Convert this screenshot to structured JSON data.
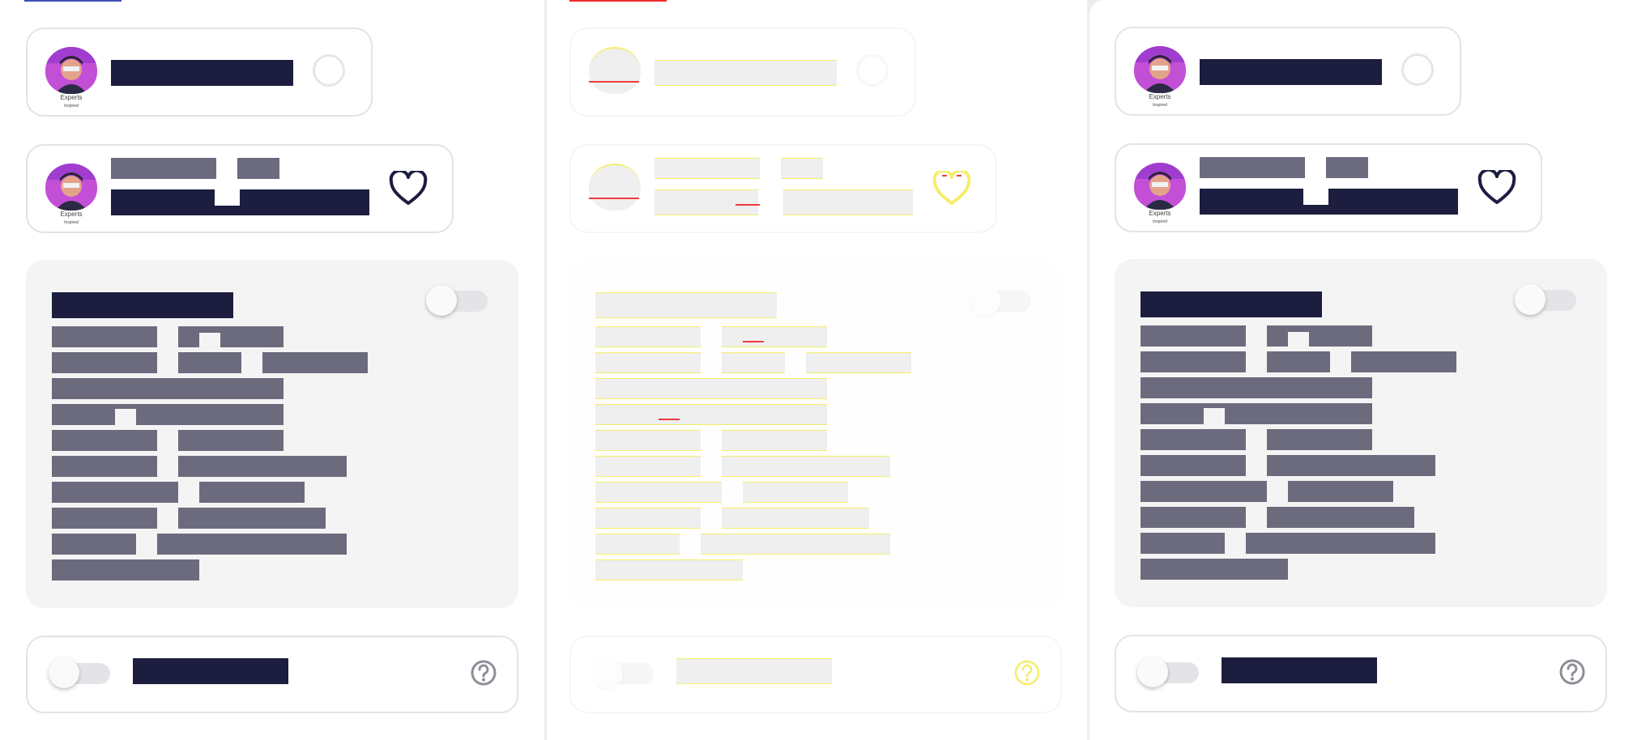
{
  "panels": [
    {
      "name": "variant-left",
      "state": "normal",
      "accent": "#3f51b5",
      "avatar_logo": "Experts",
      "avatar_sub": "Inspired"
    },
    {
      "name": "variant-middle",
      "state": "skeleton",
      "accent": "#ef2b2b",
      "avatar_logo": "",
      "avatar_sub": ""
    },
    {
      "name": "variant-right",
      "state": "normal",
      "accent": "#ffffff",
      "avatar_logo": "Experts",
      "avatar_sub": "Inspired"
    }
  ],
  "colors": {
    "text_dark": "#1c1d3f",
    "text_muted": "#6c6b7e",
    "card_border": "#e2e2e8",
    "info_card_bg": "#f4f4f4",
    "skeleton_fill": "#efefef",
    "skeleton_outline": "#f4ee6a",
    "skeleton_mark": "#ef3b3b"
  },
  "icons": {
    "favorite": "heart-outline-icon",
    "help": "question-circle-icon",
    "select": "radio-circle-icon"
  }
}
